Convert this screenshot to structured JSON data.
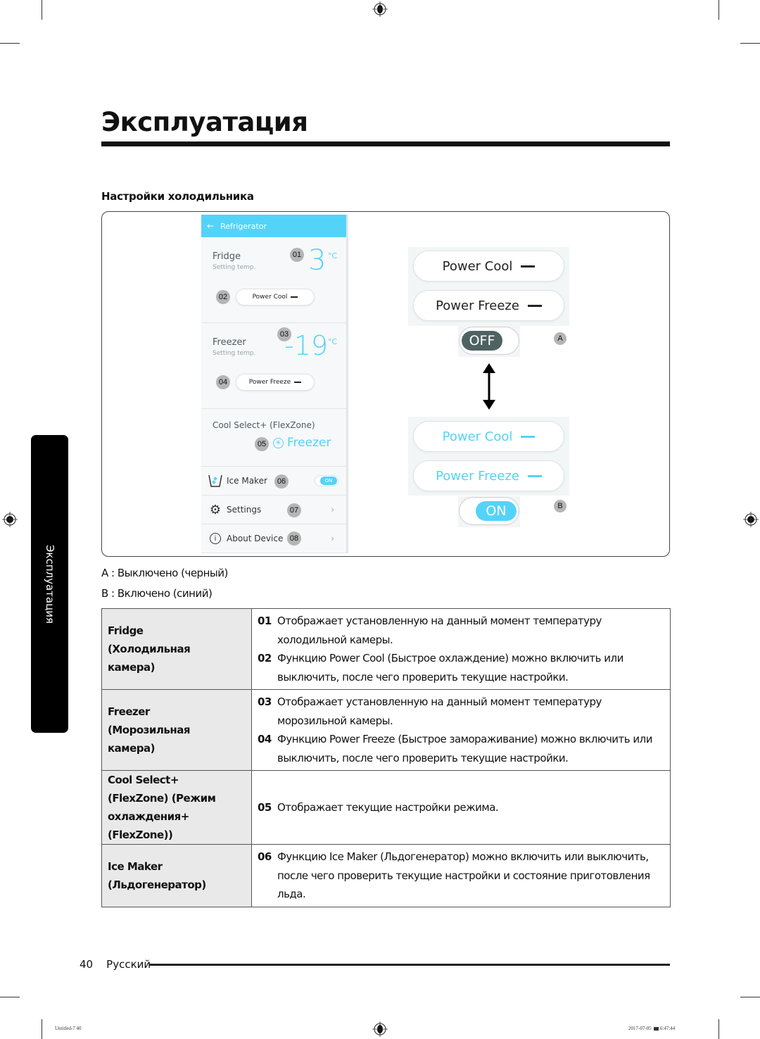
{
  "page": {
    "title": "Эксплуатация",
    "section_title": "Настройки холодильника",
    "side_tab": "Эксплуатация",
    "page_number": "40",
    "language": "Русский"
  },
  "phone": {
    "header": {
      "back_icon": "arrow-left-icon",
      "title": "Refrigerator"
    },
    "fridge": {
      "title": "Fridge",
      "subtitle": "Setting temp.",
      "temp": "3",
      "unit": "°C",
      "badge": "01",
      "power_button": "Power Cool",
      "power_badge": "02"
    },
    "freezer": {
      "title": "Freezer",
      "subtitle": "Setting temp.",
      "temp": "-19",
      "unit": "°C",
      "badge": "03",
      "power_button": "Power Freeze",
      "power_badge": "04"
    },
    "flexzone": {
      "title": "Cool Select+ (FlexZone)",
      "mode": "Freezer",
      "mode_icon": "snowflake-icon",
      "badge": "05"
    },
    "rows": [
      {
        "label": "Ice Maker",
        "badge": "06",
        "icon": "ice-cup-icon",
        "toggle": "ON"
      },
      {
        "label": "Settings",
        "badge": "07",
        "icon": "gear-icon",
        "chevron": "›"
      },
      {
        "label": "About Device",
        "badge": "08",
        "icon": "info-icon",
        "chevron": "›"
      }
    ]
  },
  "states": {
    "off": {
      "power_cool": "Power Cool",
      "power_freeze": "Power Freeze",
      "toggle": "OFF",
      "letter": "A",
      "color": "#222222",
      "knob_color": "#4f6262"
    },
    "on": {
      "power_cool": "Power Cool",
      "power_freeze": "Power Freeze",
      "toggle": "ON",
      "letter": "B",
      "color": "#54d3f8",
      "knob_color": "#54d3f8"
    }
  },
  "legend": {
    "a": "A : Выключено (черный)",
    "b": "B : Включено (синий)"
  },
  "table": [
    {
      "head": "Fridge (Холодильная камера)",
      "items": [
        {
          "n": "01",
          "text": "Отображает установленную на данный момент температуру холодильной камеры."
        },
        {
          "n": "02",
          "text": "Функцию Power Cool (Быстрое охлаждение) можно включить или выключить, после чего проверить текущие настройки."
        }
      ]
    },
    {
      "head": "Freezer (Морозильная камера)",
      "items": [
        {
          "n": "03",
          "text": "Отображает установленную на данный момент температуру морозильной камеры."
        },
        {
          "n": "04",
          "text": "Функцию Power Freeze (Быстрое замораживание) можно включить или выключить, после чего проверить текущие настройки."
        }
      ]
    },
    {
      "head": "Cool Select+ (FlexZone) (Режим охлаждения+ (FlexZone))",
      "items": [
        {
          "n": "05",
          "text": "Отображает текущие настройки режима."
        }
      ]
    },
    {
      "head": "Ice Maker (Льдогенератор)",
      "items": [
        {
          "n": "06",
          "text": "Функцию Ice Maker (Льдогенератор) можно включить или выключить, после чего проверить текущие настройки и состояние приготовления льда."
        }
      ]
    }
  ],
  "print_meta": {
    "file": "Untitled-7   40",
    "date": "2017-07-05",
    "time": "6:47:44"
  }
}
